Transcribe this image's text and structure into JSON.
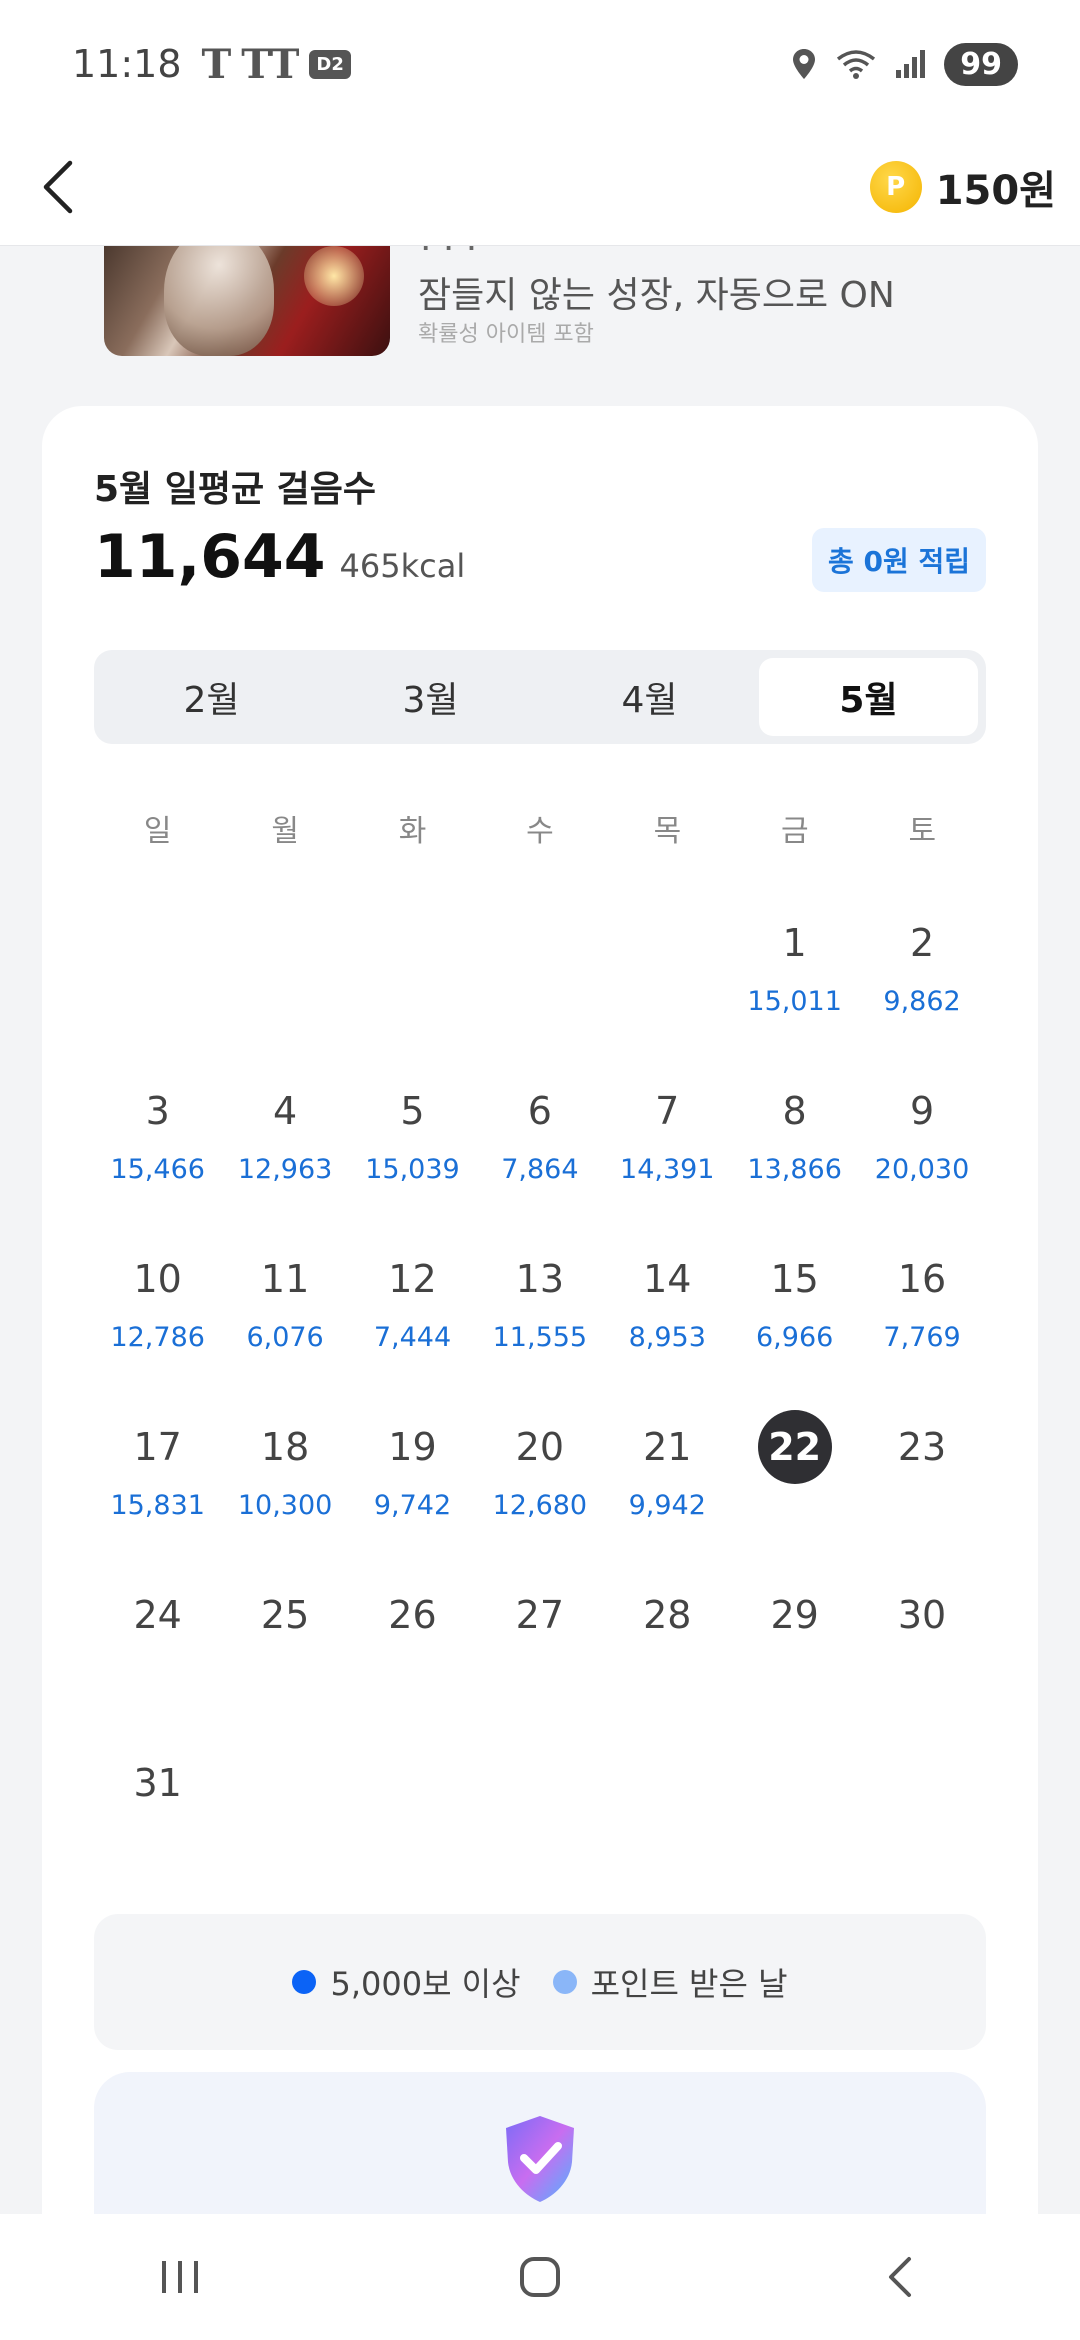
{
  "status_bar": {
    "time": "11:18",
    "carrier_glyphs": [
      "T",
      "TT"
    ],
    "d2_label": "D2",
    "battery": "99"
  },
  "header": {
    "points": "150원",
    "coin_glyph": "P"
  },
  "banner": {
    "title_partial": "· · ·",
    "subtitle": "잠들지 않는 성장, 자동으로 ON",
    "note": "확률성 아이템 포함"
  },
  "summary": {
    "title": "5월 일평균 걸음수",
    "avg_steps": "11,644",
    "kcal": "465kcal",
    "reward": "총 0원 적립"
  },
  "months": [
    {
      "label": "2월",
      "active": false
    },
    {
      "label": "3월",
      "active": false
    },
    {
      "label": "4월",
      "active": false
    },
    {
      "label": "5월",
      "active": true
    }
  ],
  "weekdays": [
    "일",
    "월",
    "화",
    "수",
    "목",
    "금",
    "토"
  ],
  "calendar": {
    "weeks": [
      [
        {
          "day": "",
          "steps": ""
        },
        {
          "day": "",
          "steps": ""
        },
        {
          "day": "",
          "steps": ""
        },
        {
          "day": "",
          "steps": ""
        },
        {
          "day": "",
          "steps": ""
        },
        {
          "day": "1",
          "steps": "15,011"
        },
        {
          "day": "2",
          "steps": "9,862"
        }
      ],
      [
        {
          "day": "3",
          "steps": "15,466"
        },
        {
          "day": "4",
          "steps": "12,963"
        },
        {
          "day": "5",
          "steps": "15,039"
        },
        {
          "day": "6",
          "steps": "7,864"
        },
        {
          "day": "7",
          "steps": "14,391"
        },
        {
          "day": "8",
          "steps": "13,866"
        },
        {
          "day": "9",
          "steps": "20,030"
        }
      ],
      [
        {
          "day": "10",
          "steps": "12,786"
        },
        {
          "day": "11",
          "steps": "6,076"
        },
        {
          "day": "12",
          "steps": "7,444"
        },
        {
          "day": "13",
          "steps": "11,555"
        },
        {
          "day": "14",
          "steps": "8,953"
        },
        {
          "day": "15",
          "steps": "6,966"
        },
        {
          "day": "16",
          "steps": "7,769"
        }
      ],
      [
        {
          "day": "17",
          "steps": "15,831"
        },
        {
          "day": "18",
          "steps": "10,300"
        },
        {
          "day": "19",
          "steps": "9,742"
        },
        {
          "day": "20",
          "steps": "12,680"
        },
        {
          "day": "21",
          "steps": "9,942"
        },
        {
          "day": "22",
          "steps": "",
          "today": true
        },
        {
          "day": "23",
          "steps": ""
        }
      ],
      [
        {
          "day": "24",
          "steps": ""
        },
        {
          "day": "25",
          "steps": ""
        },
        {
          "day": "26",
          "steps": ""
        },
        {
          "day": "27",
          "steps": ""
        },
        {
          "day": "28",
          "steps": ""
        },
        {
          "day": "29",
          "steps": ""
        },
        {
          "day": "30",
          "steps": ""
        }
      ],
      [
        {
          "day": "31",
          "steps": ""
        },
        {
          "day": "",
          "steps": ""
        },
        {
          "day": "",
          "steps": ""
        },
        {
          "day": "",
          "steps": ""
        },
        {
          "day": "",
          "steps": ""
        },
        {
          "day": "",
          "steps": ""
        },
        {
          "day": "",
          "steps": ""
        }
      ]
    ]
  },
  "legend": {
    "over_5000": "5,000보 이상",
    "point_days": "포인트 받은 날",
    "over_5000_color": "#0b63f6",
    "point_days_color": "#8ab6f8"
  },
  "colors": {
    "steps_text": "#1a6fd6",
    "today_bg": "#2f2f33",
    "badge_bg": "#e8f2ff",
    "badge_text": "#1b74d8"
  }
}
